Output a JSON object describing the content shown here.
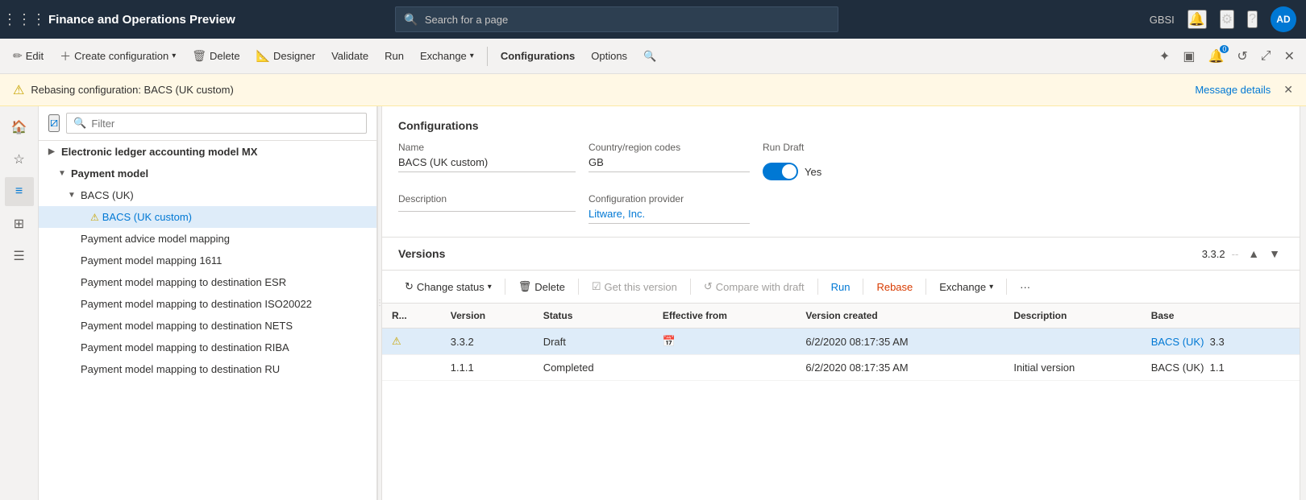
{
  "topNav": {
    "appGridIcon": "⋮⋮⋮",
    "appTitle": "Finance and Operations Preview",
    "searchPlaceholder": "Search for a page",
    "orgLabel": "GBSI",
    "bellIcon": "🔔",
    "gearIcon": "⚙",
    "helpIcon": "?",
    "userAvatar": "AD"
  },
  "toolbar": {
    "editLabel": "Edit",
    "createConfigLabel": "Create configuration",
    "deleteLabel": "Delete",
    "designerLabel": "Designer",
    "validateLabel": "Validate",
    "runLabel": "Run",
    "exchangeLabel": "Exchange",
    "configurationsLabel": "Configurations",
    "optionsLabel": "Options"
  },
  "warningBanner": {
    "text": "Rebasing configuration: BACS (UK custom)",
    "messageLinkText": "Message details"
  },
  "treePanel": {
    "filterPlaceholder": "Filter",
    "items": [
      {
        "id": "item-0",
        "level": 0,
        "text": "Electronic ledger accounting model MX",
        "expanded": false,
        "selected": false,
        "hasWarning": false,
        "expandable": true
      },
      {
        "id": "item-1",
        "level": 1,
        "text": "Payment model",
        "expanded": true,
        "selected": false,
        "hasWarning": false,
        "expandable": true
      },
      {
        "id": "item-2",
        "level": 2,
        "text": "BACS (UK)",
        "expanded": true,
        "selected": false,
        "hasWarning": false,
        "expandable": true
      },
      {
        "id": "item-3",
        "level": 3,
        "text": "⚠BACS (UK custom)",
        "expanded": false,
        "selected": true,
        "hasWarning": true,
        "expandable": false
      },
      {
        "id": "item-4",
        "level": 2,
        "text": "Payment advice model mapping",
        "expanded": false,
        "selected": false,
        "hasWarning": false,
        "expandable": false
      },
      {
        "id": "item-5",
        "level": 2,
        "text": "Payment model mapping 1611",
        "expanded": false,
        "selected": false,
        "hasWarning": false,
        "expandable": false
      },
      {
        "id": "item-6",
        "level": 2,
        "text": "Payment model mapping to destination ESR",
        "expanded": false,
        "selected": false,
        "hasWarning": false,
        "expandable": false
      },
      {
        "id": "item-7",
        "level": 2,
        "text": "Payment model mapping to destination ISO20022",
        "expanded": false,
        "selected": false,
        "hasWarning": false,
        "expandable": false
      },
      {
        "id": "item-8",
        "level": 2,
        "text": "Payment model mapping to destination NETS",
        "expanded": false,
        "selected": false,
        "hasWarning": false,
        "expandable": false
      },
      {
        "id": "item-9",
        "level": 2,
        "text": "Payment model mapping to destination RIBA",
        "expanded": false,
        "selected": false,
        "hasWarning": false,
        "expandable": false
      },
      {
        "id": "item-10",
        "level": 2,
        "text": "Payment model mapping to destination RU",
        "expanded": false,
        "selected": false,
        "hasWarning": false,
        "expandable": false
      }
    ]
  },
  "detailPanel": {
    "sectionTitle": "Configurations",
    "nameLabel": "Name",
    "nameValue": "BACS (UK custom)",
    "countryLabel": "Country/region codes",
    "countryValue": "GB",
    "runDraftLabel": "Run Draft",
    "runDraftToggleValue": "Yes",
    "descriptionLabel": "Description",
    "descriptionValue": "",
    "configProviderLabel": "Configuration provider",
    "configProviderValue": "Litware, Inc."
  },
  "versionsPanel": {
    "title": "Versions",
    "currentVersion": "3.3.2",
    "separator": "--",
    "versionsToolbar": {
      "changeStatusLabel": "Change status",
      "deleteLabel": "Delete",
      "getThisVersionLabel": "Get this version",
      "compareWithDraftLabel": "Compare with draft",
      "runLabel": "Run",
      "rebaseLabel": "Rebase",
      "exchangeLabel": "Exchange",
      "moreLabel": "···"
    },
    "tableHeaders": {
      "col0": "R...",
      "col1": "Version",
      "col2": "Status",
      "col3": "Effective from",
      "col4": "Version created",
      "col5": "Description",
      "col6": "Base"
    },
    "rows": [
      {
        "id": "row-0",
        "selected": true,
        "warning": true,
        "version": "3.3.2",
        "status": "Draft",
        "effectiveFrom": "",
        "hasCalendar": true,
        "versionCreated": "6/2/2020 08:17:35 AM",
        "description": "",
        "base": "BACS (UK)",
        "baseVersion": "3.3",
        "baseLink": true
      },
      {
        "id": "row-1",
        "selected": false,
        "warning": false,
        "version": "1.1.1",
        "status": "Completed",
        "effectiveFrom": "",
        "hasCalendar": false,
        "versionCreated": "6/2/2020 08:17:35 AM",
        "description": "Initial version",
        "base": "BACS (UK)",
        "baseVersion": "1.1",
        "baseLink": false
      }
    ]
  }
}
